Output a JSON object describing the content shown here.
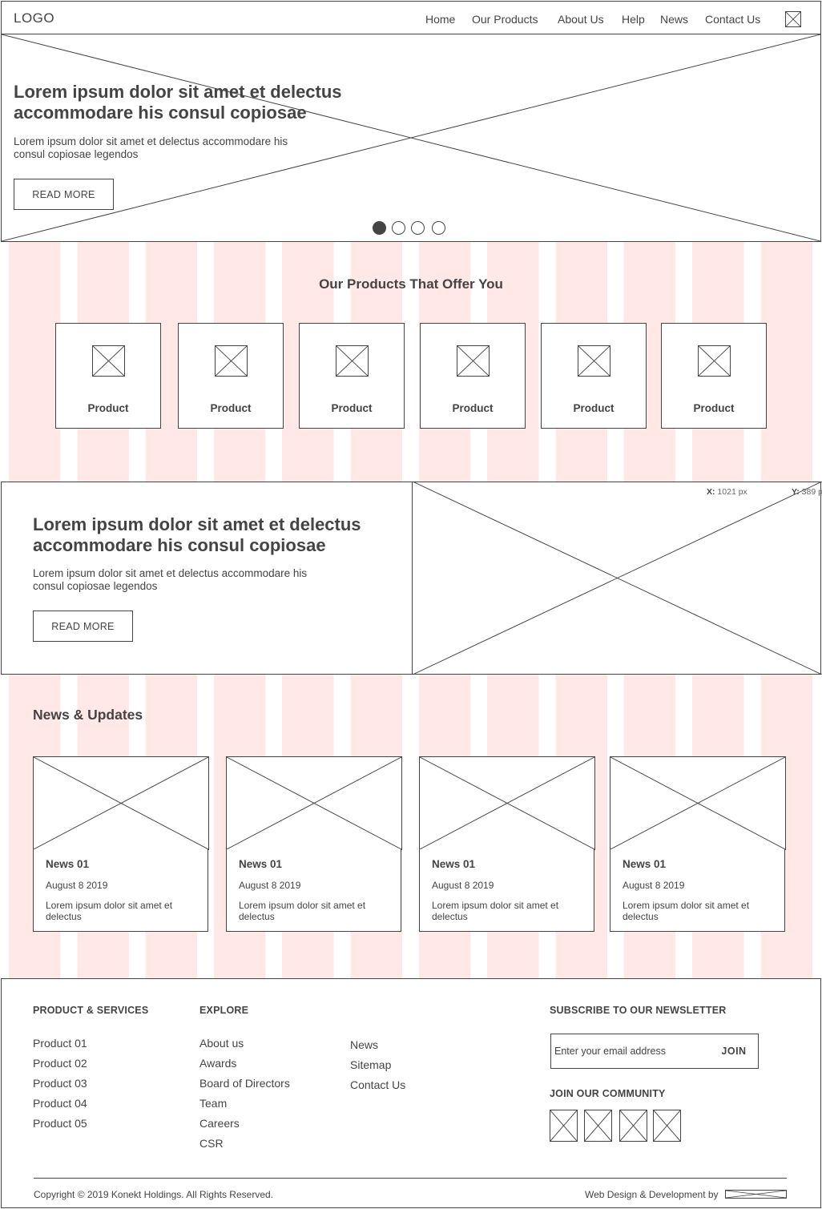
{
  "header": {
    "logo": "LOGO",
    "nav": [
      "Home",
      "Our Products",
      "About Us",
      "Help",
      "News",
      "Contact Us"
    ],
    "icon": "image-placeholder-icon"
  },
  "hero": {
    "title": "Lorem ipsum dolor sit amet et delectus accommodare his consul copiosae",
    "text": "Lorem ipsum dolor sit amet et delectus accommodare his consul copiosae legendos",
    "button": "READ MORE",
    "slides": 4,
    "active_slide": 1
  },
  "products": {
    "title": "Our Products That Offer You",
    "items": [
      "Product",
      "Product",
      "Product",
      "Product",
      "Product",
      "Product"
    ]
  },
  "feature": {
    "title": "Lorem ipsum dolor sit amet et delectus accommodare his consul copiosae",
    "text": "Lorem ipsum dolor sit amet et delectus accommodare his consul copiosae legendos",
    "button": "READ MORE",
    "coord_x_label": "X:",
    "coord_x_value": "1021 px",
    "coord_y_label": "Y:",
    "coord_y_value": "389 p"
  },
  "news": {
    "title": "News & Updates",
    "items": [
      {
        "title": "News 01",
        "date": "August 8 2019",
        "text": "Lorem ipsum dolor sit amet et delectus"
      },
      {
        "title": "News 01",
        "date": "August 8 2019",
        "text": "Lorem ipsum dolor sit amet et delectus"
      },
      {
        "title": "News 01",
        "date": "August 8 2019",
        "text": "Lorem ipsum dolor sit amet et delectus"
      },
      {
        "title": "News 01",
        "date": "August 8 2019",
        "text": "Lorem ipsum dolor sit amet et delectus"
      }
    ]
  },
  "footer": {
    "products_heading": "PRODUCT & SERVICES",
    "products": [
      "Product 01",
      "Product 02",
      "Product 03",
      "Product 04",
      "Product 05"
    ],
    "explore_heading": "EXPLORE",
    "explore": [
      "About us",
      "Awards",
      "Board of Directors",
      "Team",
      "Careers",
      "CSR"
    ],
    "more": [
      "News",
      "Sitemap",
      "Contact Us"
    ],
    "newsletter_heading": "SUBSCRIBE TO OUR NEWSLETTER",
    "email_placeholder": "Enter your email address",
    "join": "JOIN",
    "community_heading": "JOIN OUR COMMUNITY",
    "social_icons": [
      "social-icon",
      "social-icon",
      "social-icon",
      "social-icon"
    ],
    "copyright": "Copyright © 2019 Konekt Holdings. All Rights Reserved.",
    "credit": "Web Design & Development by"
  },
  "colors": {
    "stroke": "#444444",
    "grid_stripe": "#ffe8e6",
    "background": "#ffffff"
  }
}
